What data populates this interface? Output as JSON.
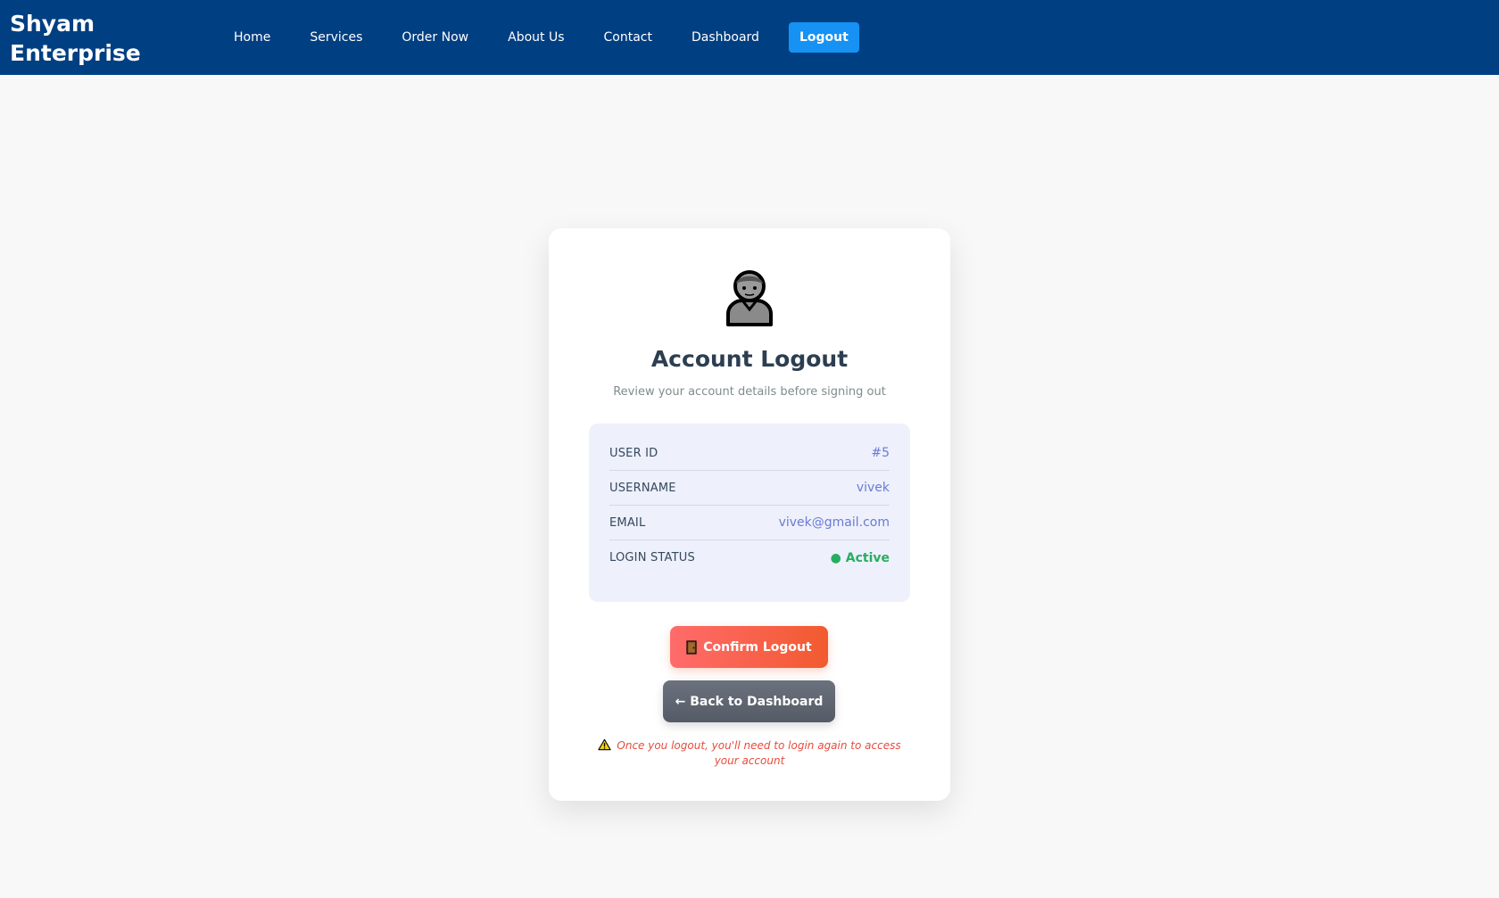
{
  "nav": {
    "brand": "Shyam Enterprise",
    "links": [
      "Home",
      "Services",
      "Order Now",
      "About Us",
      "Contact",
      "Dashboard"
    ],
    "logout_label": "Logout"
  },
  "card": {
    "avatar_icon": "person-icon",
    "title": "Account Logout",
    "subtitle": "Review your account details before signing out",
    "info": [
      {
        "label": "USER ID",
        "value": "#5"
      },
      {
        "label": "USERNAME",
        "value": "vivek"
      },
      {
        "label": "EMAIL",
        "value": "vivek@gmail.com"
      },
      {
        "label": "LOGIN STATUS",
        "value": "● Active"
      }
    ],
    "confirm_label": "Confirm Logout",
    "confirm_icon": "door-icon",
    "back_label": "← Back to Dashboard",
    "warning_icon": "warning-icon",
    "warning": "Once you logout, you'll need to login again to access your account"
  },
  "colors": {
    "navbar": "#003f82",
    "logout_button": "#1592f4",
    "confirm_gradient_start": "#ff6b6b",
    "confirm_gradient_end": "#f25a2f",
    "back_button": "#5f6570",
    "status_active": "#27ae60",
    "info_value": "#6a7bd6",
    "warning_text": "#e74c3c"
  }
}
